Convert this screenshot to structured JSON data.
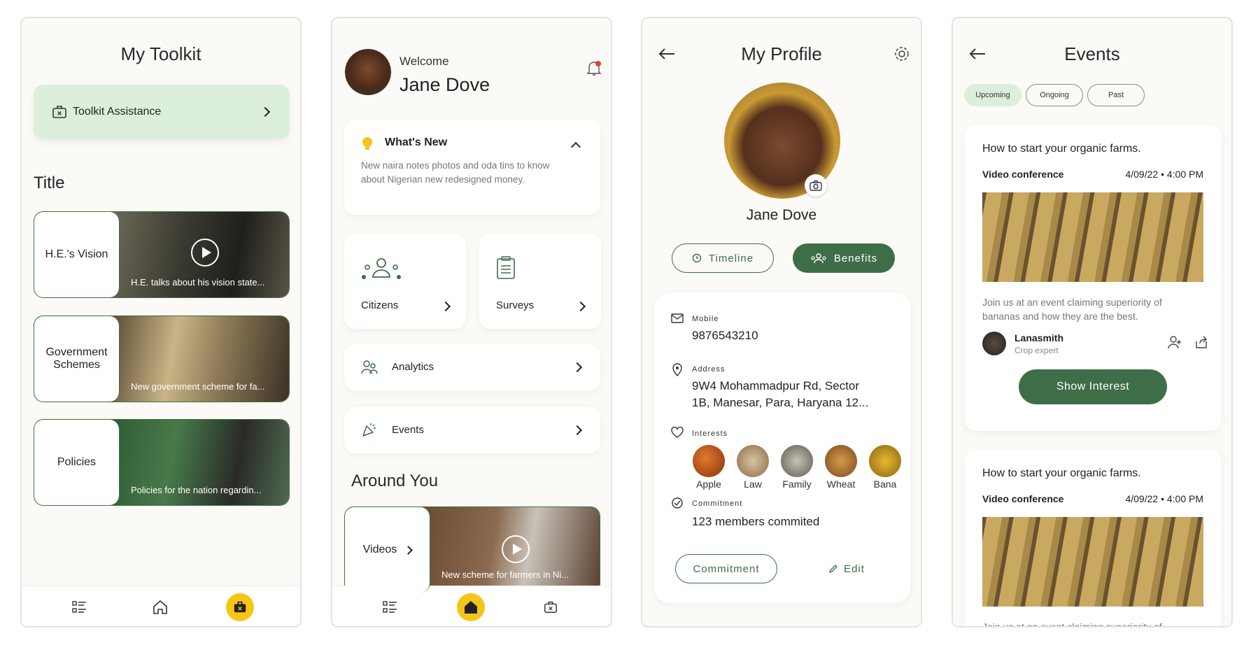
{
  "toolkit": {
    "title": "My Toolkit",
    "assistance_label": "Toolkit Assistance",
    "section_title": "Title",
    "items": [
      {
        "label": "H.E.'s Vision",
        "caption": "H.E. talks about his vision state..."
      },
      {
        "label": "Government Schemes",
        "caption": "New government scheme for fa..."
      },
      {
        "label": "Policies",
        "caption": "Policies for the nation regardin..."
      }
    ]
  },
  "home": {
    "welcome": "Welcome",
    "user_name": "Jane Dove",
    "whats_new_title": "What's New",
    "whats_new_text": "New naira notes photos and oda tins to know about Nigerian new redesigned money.",
    "citizens_label": "Citizens",
    "surveys_label": "Surveys",
    "analytics_label": "Analytics",
    "events_label": "Events",
    "around_title": "Around You",
    "videos_label": "Videos",
    "videos_caption": "New scheme for farmers in Ni..."
  },
  "profile": {
    "title": "My Profile",
    "name": "Jane Dove",
    "timeline_label": "Timeline",
    "benefits_label": "Benefits",
    "mobile_label": "Mobile",
    "mobile_value": "9876543210",
    "address_label": "Address",
    "address_line1": "9W4 Mohammadpur Rd, Sector",
    "address_line2": "1B, Manesar, Para, Haryana 12...",
    "interests_label": "Interests",
    "interests": [
      "Apple",
      "Law",
      "Family",
      "Wheat",
      "Bana"
    ],
    "commitment_label": "Commitment",
    "commitment_value": "123 members commited",
    "commitment_button": "Commitment",
    "edit_label": "Edit"
  },
  "events": {
    "title": "Events",
    "tabs": [
      "Upcoming",
      "Ongoing",
      "Past"
    ],
    "cards": [
      {
        "title": "How to start your organic farms.",
        "type": "Video conference",
        "datetime": "4/09/22 • 4:00 PM",
        "description": "Join us at an event claiming superiority of bananas and how they are the best.",
        "host_name": "Lanasmith",
        "host_role": "Crop expert",
        "button": "Show Interest"
      },
      {
        "title": "How to start your organic farms.",
        "type": "Video conference",
        "datetime": "4/09/22 • 4:00 PM",
        "description": "Join us at an event claiming superiority of"
      }
    ]
  },
  "colors": {
    "accent": "#3e6e47",
    "highlight": "#f5c518",
    "mint": "#dcefdc",
    "bg": "#fbfaf6"
  }
}
